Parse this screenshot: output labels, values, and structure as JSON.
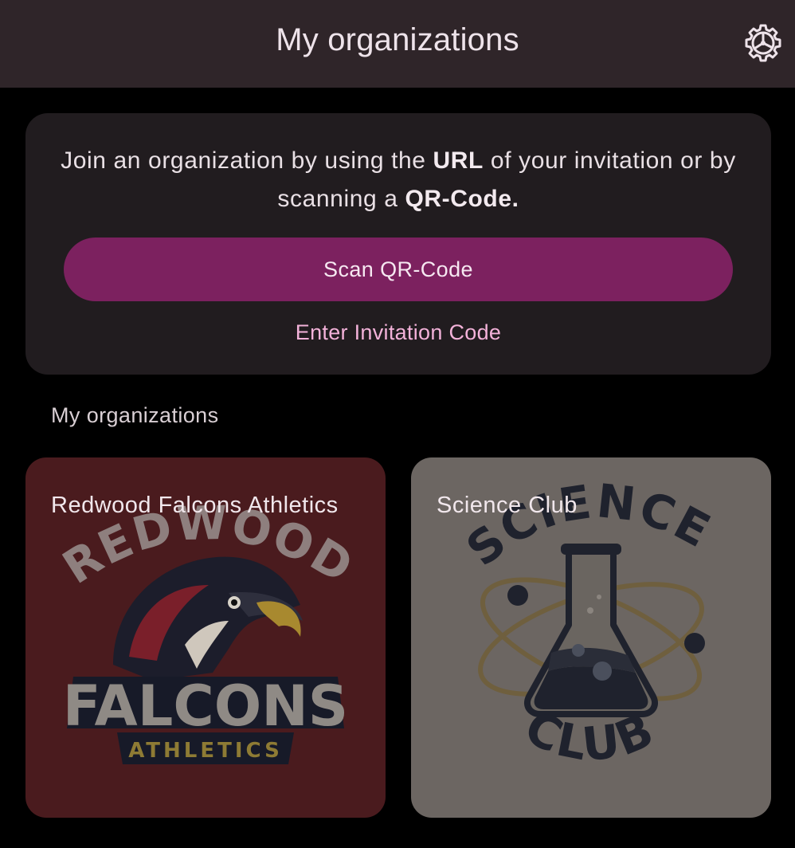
{
  "header": {
    "title": "My organizations",
    "settings_icon": "gear-icon"
  },
  "join": {
    "text_before_url": "Join an organization by using the ",
    "text_url": "URL",
    "text_middle": " of your invitation or by scanning a ",
    "text_qr": "QR-Code.",
    "scan_button_label": "Scan QR-Code",
    "invite_link_label": "Enter Invitation Code"
  },
  "organizations_section": {
    "label": "My organizations",
    "items": [
      {
        "name": "Redwood Falcons Athletics",
        "logo_arc_text": "REDWOOD",
        "logo_main_text": "FALCONS",
        "logo_sub_text": "ATHLETICS"
      },
      {
        "name": "Science Club",
        "logo_arc_text": "SCIENCE",
        "logo_sub_text": "CLUB"
      }
    ]
  },
  "colors": {
    "appbar": "#2f2529",
    "card": "#211c1f",
    "accent": "#7c215f",
    "link": "#f3b2d9",
    "redwood_card": "#4a1b1e",
    "science_card": "#6c6662"
  }
}
